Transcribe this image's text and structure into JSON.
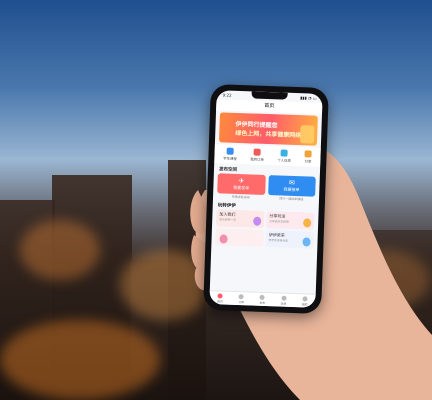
{
  "phone": {
    "status": {
      "time": "9:22",
      "signal": "▮▮▮ ◔ ▭"
    },
    "title": "首页",
    "banner": {
      "line1": "伊伊同行提醒您",
      "line2": "绿色上网，共享健康网络"
    },
    "quick_icons": [
      {
        "label": "学生课程",
        "color": "#3a8cf0"
      },
      {
        "label": "我的订单",
        "color": "#f05a5a"
      },
      {
        "label": "个人信息",
        "color": "#3cb0e0"
      },
      {
        "label": "分享",
        "color": "#f0a23a"
      }
    ],
    "section_publish": "发布空间",
    "publish_cards": [
      {
        "label": "我要发单",
        "icon": "✈",
        "color": "#ff6b6b"
      },
      {
        "label": "我要接单",
        "icon": "✉",
        "color": "#2f8cf0"
      }
    ],
    "publish_sub": [
      "有需求就发布",
      "同行一起接单赚钱"
    ],
    "section_play": "玩转伊伊",
    "play_tiles": [
      {
        "title": "加入我们",
        "sub": "成为伊伊一员",
        "bg": "#fde7e7",
        "accent": "#c58bf0"
      },
      {
        "title": "分享玩法",
        "sub": "分享给好友获得",
        "bg": "#fde9ee",
        "accent": "#f5b44a"
      },
      {
        "title": "",
        "sub": "",
        "bg": "#fdeef0",
        "accent": "#f08fb0"
      },
      {
        "title": "伊伊奖采",
        "sub": "伊伊奖采等你来",
        "bg": "#eef2fd",
        "accent": "#6bb6f0"
      }
    ],
    "tabs": [
      {
        "label": "首页",
        "active": true
      },
      {
        "label": "订单",
        "active": false
      },
      {
        "label": "发布",
        "active": false
      },
      {
        "label": "消息",
        "active": false
      },
      {
        "label": "我的",
        "active": false
      }
    ]
  }
}
